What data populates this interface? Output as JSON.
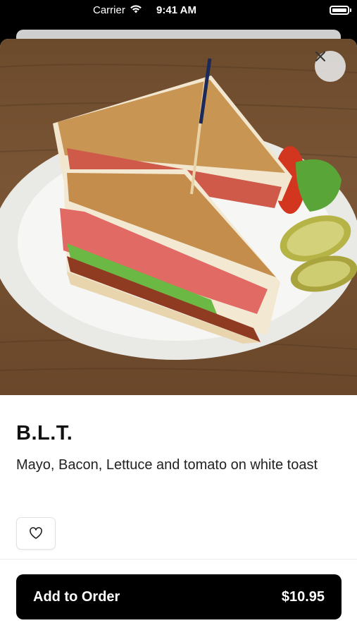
{
  "status_bar": {
    "carrier": "Carrier",
    "time": "9:41 AM"
  },
  "item": {
    "name": "B.L.T.",
    "description": "Mayo, Bacon, Lettuce and tomato on white toast",
    "image_alt": "BLT sandwich on a white plate with pickles"
  },
  "actions": {
    "add_to_order_label": "Add to Order",
    "price": "$10.95"
  },
  "icons": {
    "close": "close-icon",
    "favorite": "heart-icon",
    "wifi": "wifi-icon",
    "battery": "battery-icon"
  },
  "colors": {
    "primary_button": "#000000",
    "sheet": "#ffffff"
  }
}
